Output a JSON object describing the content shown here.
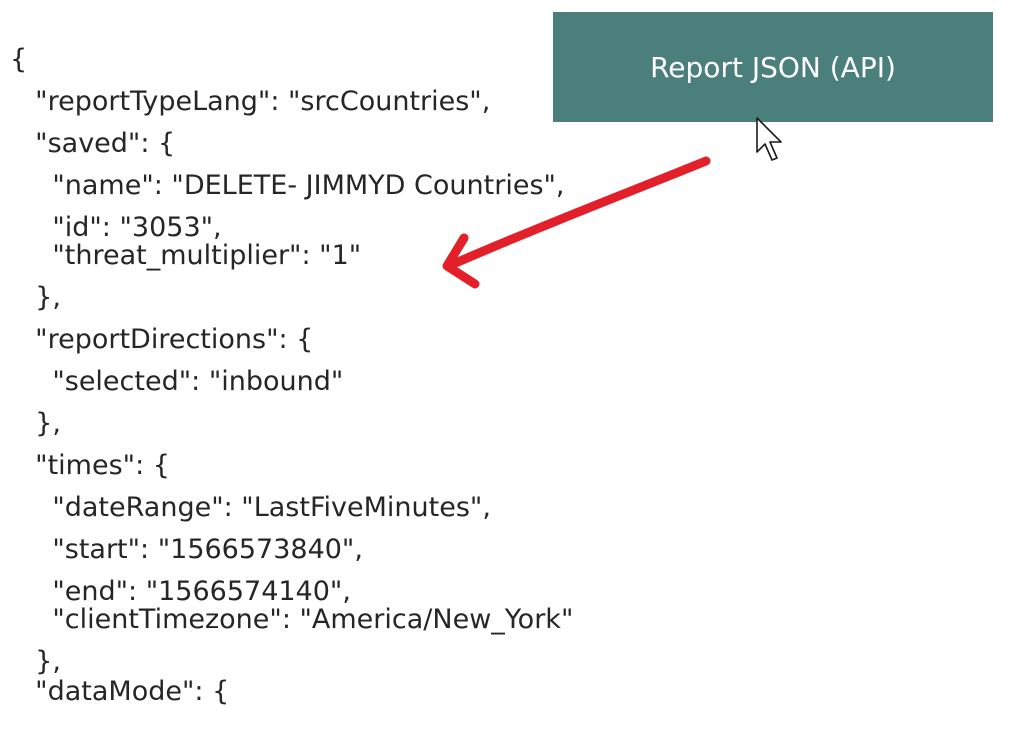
{
  "toolbar": {
    "report_json_label": "Report JSON (API)"
  },
  "json_view": {
    "lines": [
      "{",
      "  \"reportTypeLang\": \"srcCountries\",",
      "  \"saved\": {",
      "    \"name\": \"DELETE- JIMMYD Countries\",",
      "    \"id\": \"3053\",",
      "    \"threat_multiplier\": \"1\"",
      "  },",
      "  \"reportDirections\": {",
      "    \"selected\": \"inbound\"",
      "  },",
      "  \"times\": {",
      "    \"dateRange\": \"LastFiveMinutes\",",
      "    \"start\": \"1566573840\",",
      "    \"end\": \"1566574140\",",
      "    \"clientTimezone\": \"America/New_York\"",
      "  },",
      "  \"dataMode\": {"
    ]
  },
  "annotation": {
    "arrow_color": "#e3202a",
    "arrow_icon": "red-arrow-icon"
  },
  "cursor": {
    "icon": "mouse-pointer-icon"
  },
  "colors": {
    "button_bg": "#4a7f7b",
    "text": "#262626"
  }
}
